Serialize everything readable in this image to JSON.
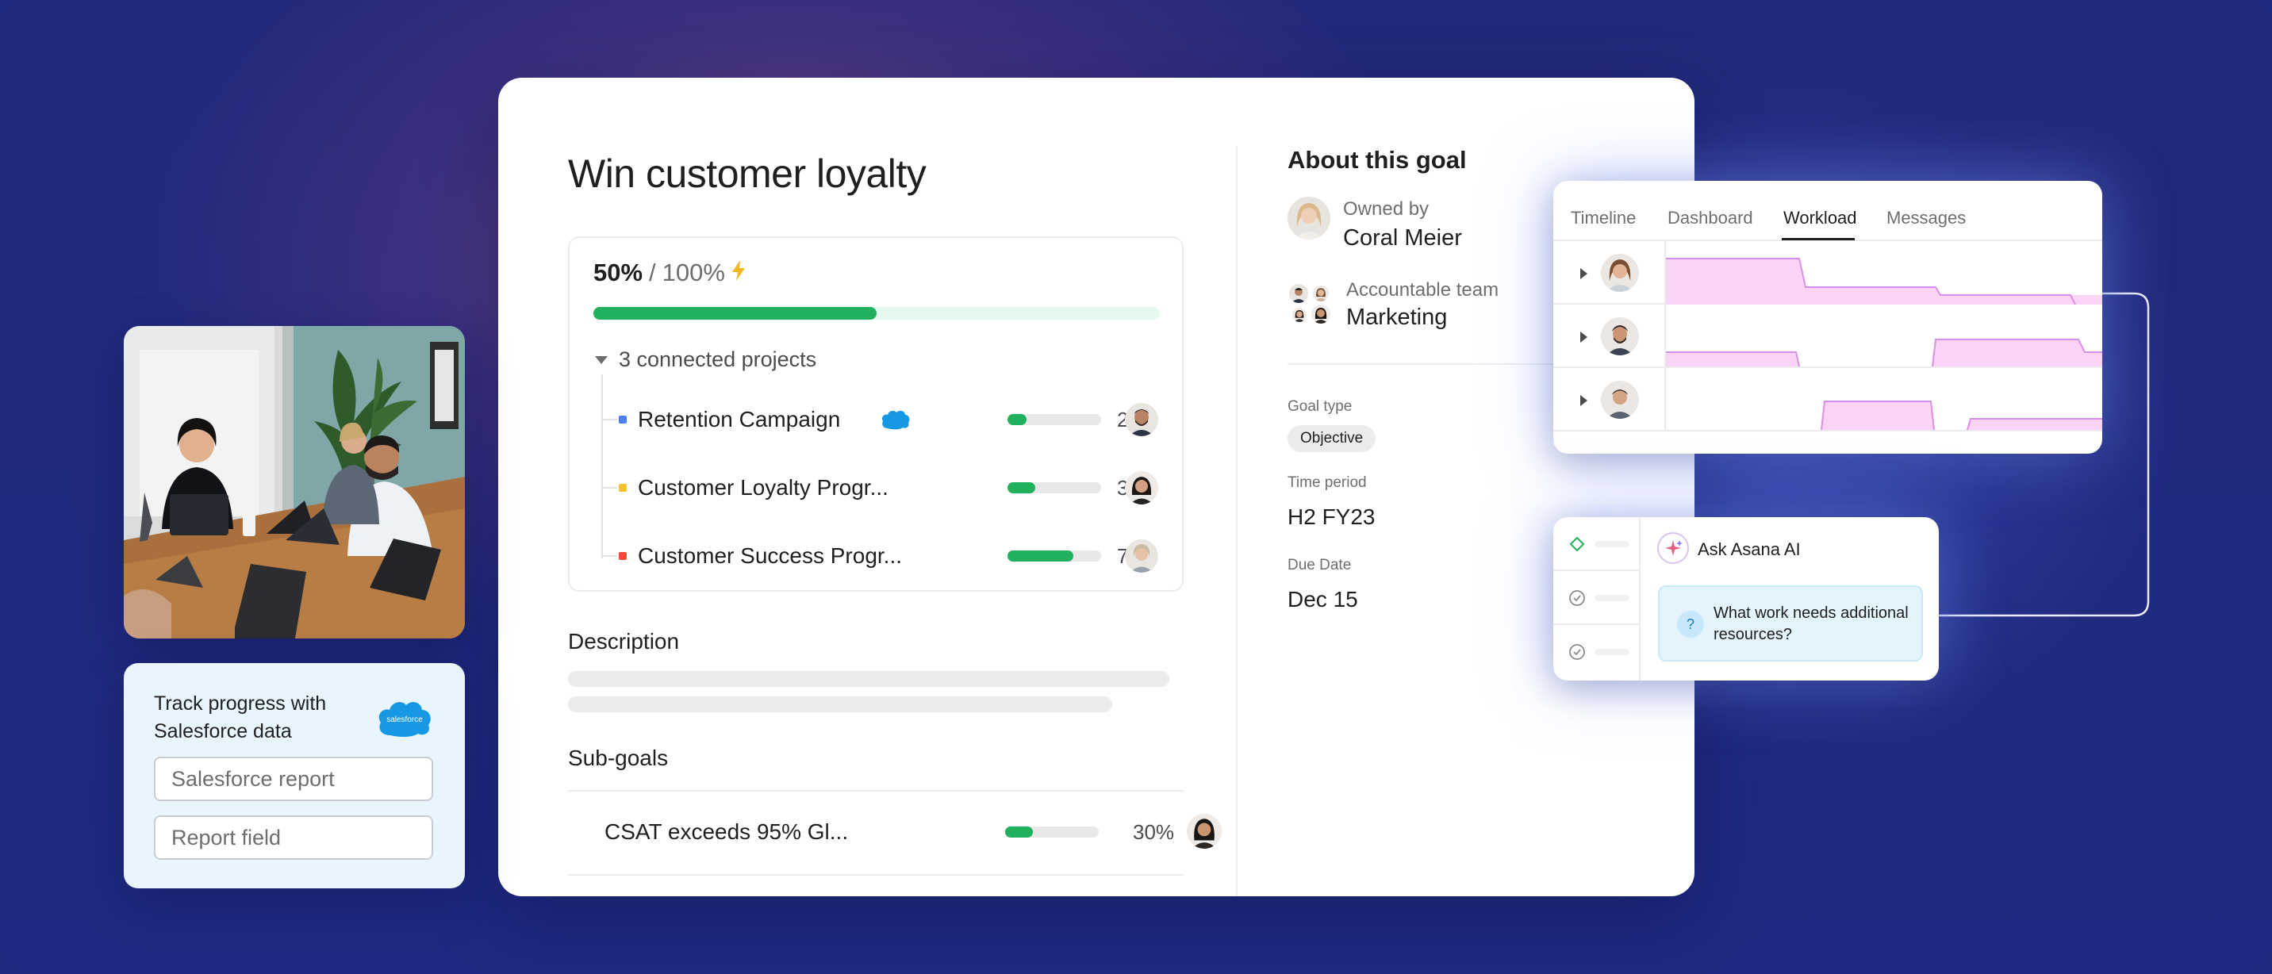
{
  "goal": {
    "title": "Win customer loyalty",
    "progress": {
      "current": "50%",
      "separator": "/",
      "target": "100%",
      "fraction": 0.5
    },
    "connected_projects_label": "3 connected projects",
    "projects": [
      {
        "name": "Retention Campaign",
        "percent": "20%",
        "fraction": 0.2,
        "dot_color": "#4f7df3",
        "has_salesforce": true
      },
      {
        "name": "Customer Loyalty Progr...",
        "percent": "30%",
        "fraction": 0.3,
        "dot_color": "#f2c230",
        "has_salesforce": false
      },
      {
        "name": "Customer Success Progr...",
        "percent": "70%",
        "fraction": 0.7,
        "dot_color": "#ef4a3c",
        "has_salesforce": false
      }
    ],
    "description_label": "Description",
    "subgoals_label": "Sub-goals",
    "subgoals": [
      {
        "name": "CSAT exceeds 95% Gl...",
        "percent": "30%",
        "fraction": 0.3
      }
    ]
  },
  "about": {
    "heading": "About this goal",
    "owner_label": "Owned by",
    "owner_name": "Coral Meier",
    "team_label": "Accountable team",
    "team_name": "Marketing",
    "goal_type_label": "Goal type",
    "goal_type_value": "Objective",
    "time_period_label": "Time period",
    "time_period_value": "H2 FY23",
    "due_date_label": "Due Date",
    "due_date_value": "Dec 15"
  },
  "salesforce": {
    "title": "Track progress with Salesforce data",
    "logo_text": "salesforce",
    "report_placeholder": "Salesforce report",
    "field_placeholder": "Report field"
  },
  "workload": {
    "tabs": [
      "Timeline",
      "Dashboard",
      "Workload",
      "Messages"
    ],
    "active_tab": "Workload"
  },
  "ai": {
    "title": "Ask Asana AI",
    "question": "What work needs additional resources?",
    "badge": "?"
  },
  "colors": {
    "accent_green": "#21b15c",
    "background": "#202a7e",
    "workload_fill": "#fbd4f5",
    "workload_stroke": "#d98fe6"
  },
  "icons": [
    "bolt-icon",
    "salesforce-cloud-icon",
    "chevron-down-icon",
    "chevron-right-icon",
    "diamond-icon",
    "check-circle-icon",
    "sparkle-icon",
    "question-icon"
  ]
}
